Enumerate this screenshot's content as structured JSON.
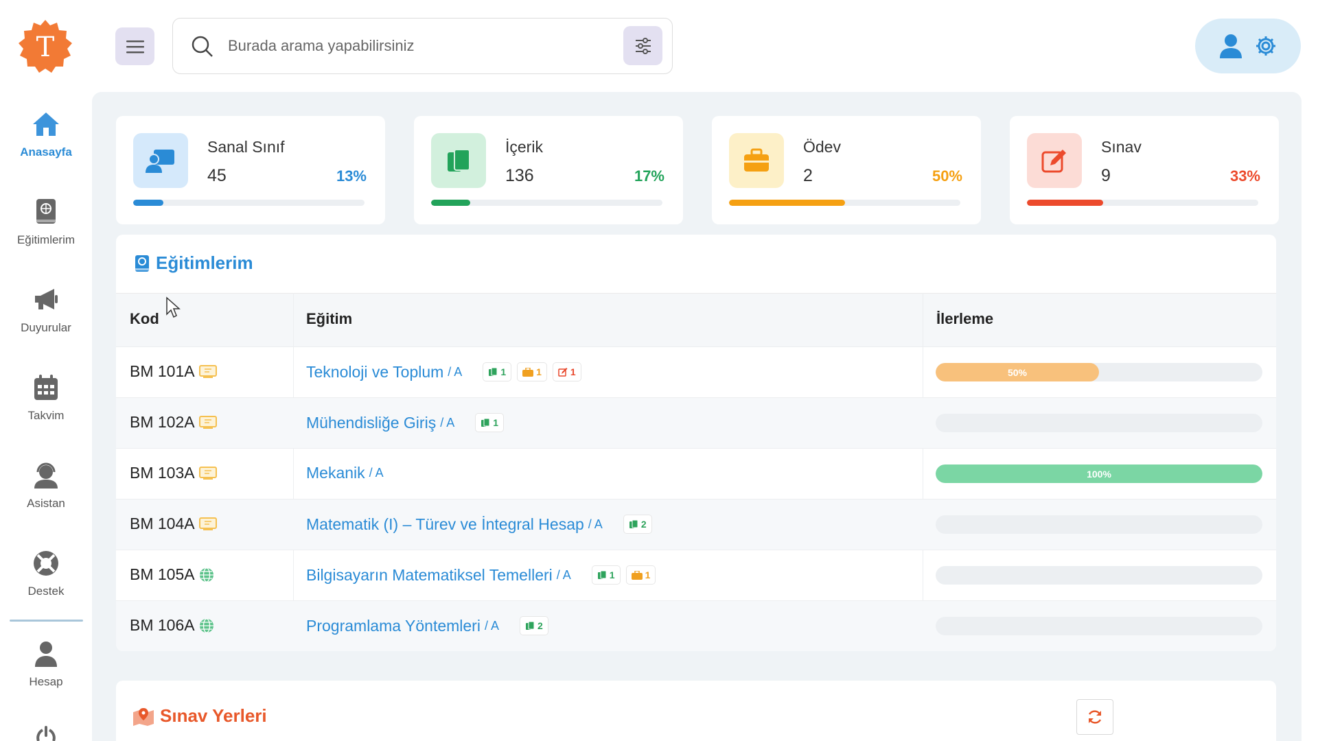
{
  "search": {
    "placeholder": "Burada arama yapabilirsiniz"
  },
  "logo": {
    "letter": "T",
    "color": "#f27a35"
  },
  "sidebar": {
    "items": [
      {
        "label": "Anasayfa",
        "icon": "home-icon",
        "active": true
      },
      {
        "label": "Eğitimlerim",
        "icon": "book-globe-icon"
      },
      {
        "label": "Duyurular",
        "icon": "megaphone-icon"
      },
      {
        "label": "Takvim",
        "icon": "calendar-icon"
      },
      {
        "label": "Asistan",
        "icon": "headset-icon"
      },
      {
        "label": "Destek",
        "icon": "lifebuoy-icon"
      },
      {
        "label": "Hesap",
        "icon": "user-icon"
      }
    ]
  },
  "stats": [
    {
      "title": "Sanal Sınıf",
      "count": "45",
      "percent": "13%",
      "progress": 13,
      "color": "#2a8bd6",
      "icon": "virtual-class-icon"
    },
    {
      "title": "İçerik",
      "count": "136",
      "percent": "17%",
      "progress": 17,
      "color": "#22a35a",
      "icon": "content-icon"
    },
    {
      "title": "Ödev",
      "count": "2",
      "percent": "50%",
      "progress": 50,
      "color": "#f5a012",
      "icon": "briefcase-icon"
    },
    {
      "title": "Sınav",
      "count": "9",
      "percent": "33%",
      "progress": 33,
      "color": "#ec4a2c",
      "icon": "exam-edit-icon"
    }
  ],
  "courses": {
    "title": "Eğitimlerim",
    "headers": {
      "code": "Kod",
      "course": "Eğitim",
      "progress": "İlerleme"
    },
    "rows": [
      {
        "code": "BM 101A",
        "code_icon": "classroom-icon",
        "title": "Teknoloji ve Toplum",
        "section": "/ A",
        "badges": [
          {
            "type": "content",
            "count": "1"
          },
          {
            "type": "assignment",
            "count": "1"
          },
          {
            "type": "exam",
            "count": "1"
          }
        ],
        "progress": 50,
        "progress_label": "50%"
      },
      {
        "code": "BM 102A",
        "code_icon": "classroom-icon",
        "title": "Mühendisliğe Giriş",
        "section": "/ A",
        "badges": [
          {
            "type": "content",
            "count": "1"
          }
        ],
        "progress": 0,
        "progress_label": ""
      },
      {
        "code": "BM 103A",
        "code_icon": "classroom-icon",
        "title": "Mekanik",
        "section": "/ A",
        "badges": [],
        "progress": 100,
        "progress_label": "100%"
      },
      {
        "code": "BM 104A",
        "code_icon": "classroom-icon",
        "title": "Matematik (I) – Türev ve İntegral Hesap",
        "section": "/ A",
        "badges": [
          {
            "type": "content",
            "count": "2"
          }
        ],
        "progress": 0,
        "progress_label": ""
      },
      {
        "code": "BM 105A",
        "code_icon": "globe-icon",
        "title": "Bilgisayarın Matematiksel Temelleri",
        "section": "/ A",
        "badges": [
          {
            "type": "content",
            "count": "1"
          },
          {
            "type": "assignment",
            "count": "1"
          }
        ],
        "progress": 0,
        "progress_label": ""
      },
      {
        "code": "BM 106A",
        "code_icon": "globe-icon",
        "title": "Programlama Yöntemleri",
        "section": "/ A",
        "badges": [
          {
            "type": "content",
            "count": "2"
          }
        ],
        "progress": 0,
        "progress_label": ""
      }
    ]
  },
  "exam_places": {
    "title": "Sınav Yerleri"
  }
}
